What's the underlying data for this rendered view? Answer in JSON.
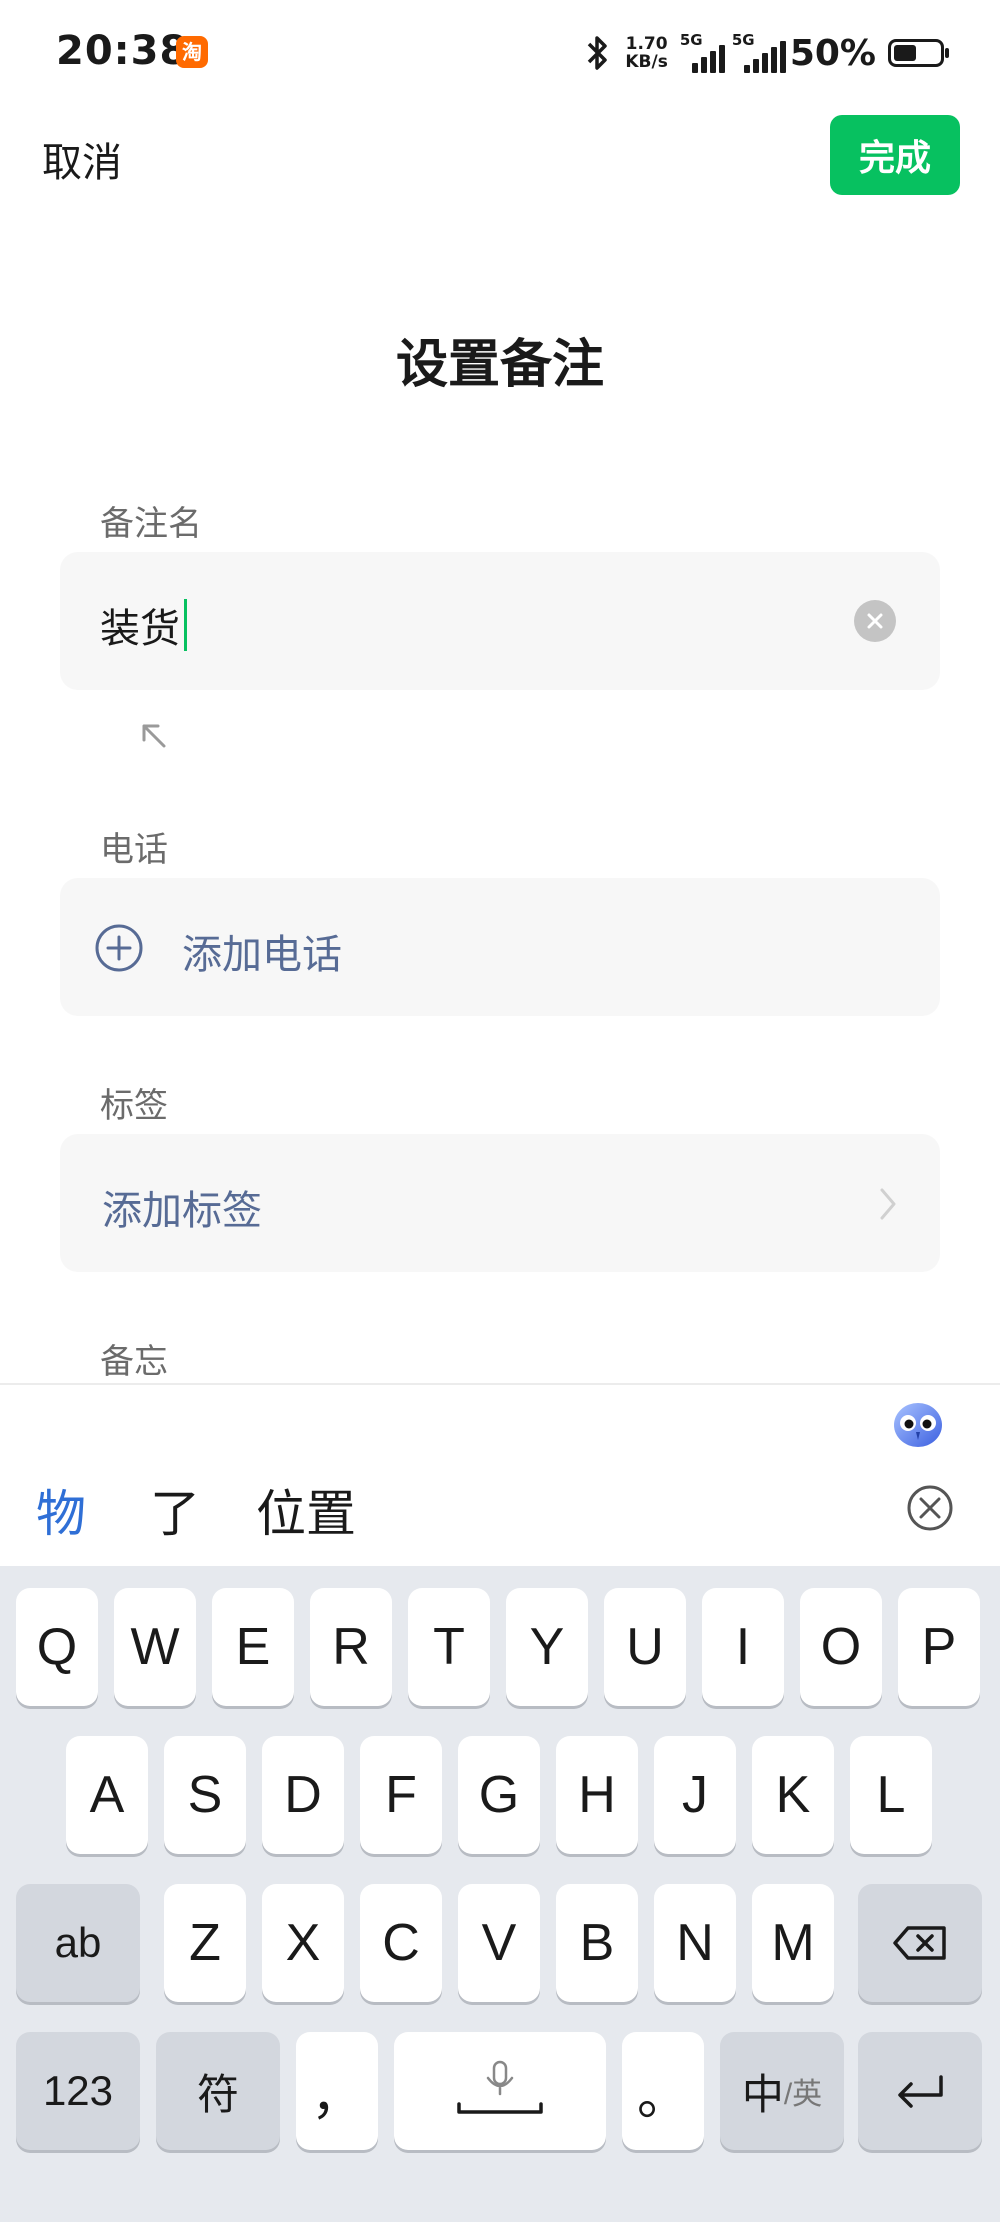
{
  "status_bar": {
    "time": "20:38",
    "app_badge": "淘",
    "net_speed_value": "1.70",
    "net_speed_unit": "KB/s",
    "sim1": "5G",
    "sim2": "5G",
    "battery": "50%",
    "battery_level": 0.5
  },
  "nav": {
    "cancel": "取消",
    "done": "完成"
  },
  "title": "设置备注",
  "remark": {
    "label": "备注名",
    "value": "装货"
  },
  "phone": {
    "label": "电话",
    "add": "添加电话"
  },
  "tags": {
    "label": "标签",
    "add": "添加标签"
  },
  "memo": {
    "label": "备忘"
  },
  "candidates": [
    "物",
    "了",
    "位置"
  ],
  "keyboard": {
    "row1": [
      "Q",
      "W",
      "E",
      "R",
      "T",
      "Y",
      "U",
      "I",
      "O",
      "P"
    ],
    "row2": [
      "A",
      "S",
      "D",
      "F",
      "G",
      "H",
      "J",
      "K",
      "L"
    ],
    "row3": [
      "Z",
      "X",
      "C",
      "V",
      "B",
      "N",
      "M"
    ],
    "shift": "ab",
    "num": "123",
    "symbol": "符",
    "comma": "，",
    "period": "。",
    "lang_main": "中",
    "lang_alt": "/英"
  },
  "colors": {
    "accent": "#07c160",
    "link": "#576b95",
    "candidate_highlight": "#2f6fd6"
  }
}
